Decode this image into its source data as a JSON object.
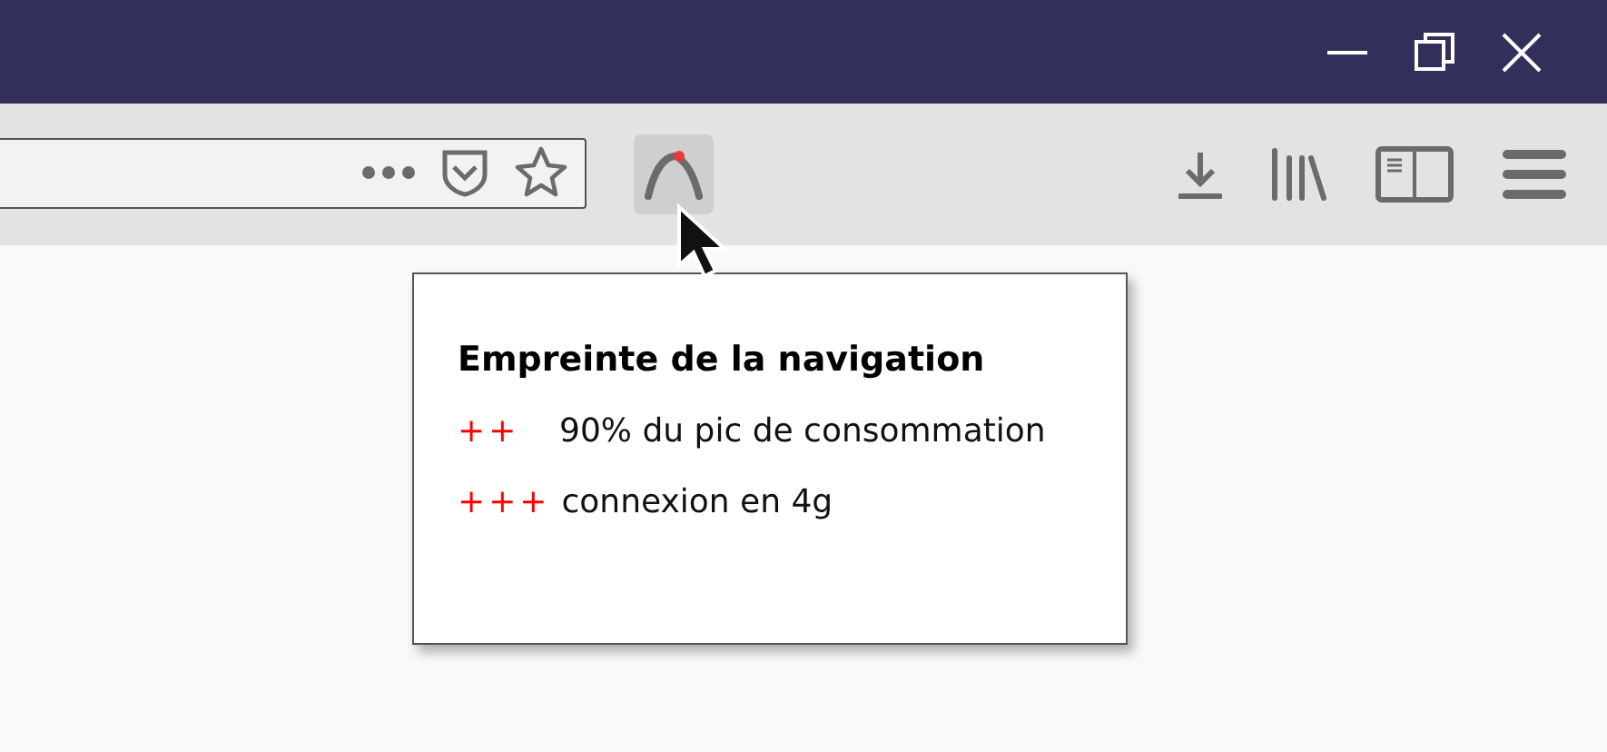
{
  "tooltip": {
    "title": "Empreinte de la navigation",
    "lines": [
      {
        "marker": "++",
        "text": "90% du pic de consommation"
      },
      {
        "marker": "+++",
        "text": "connexion en 4g"
      }
    ]
  }
}
